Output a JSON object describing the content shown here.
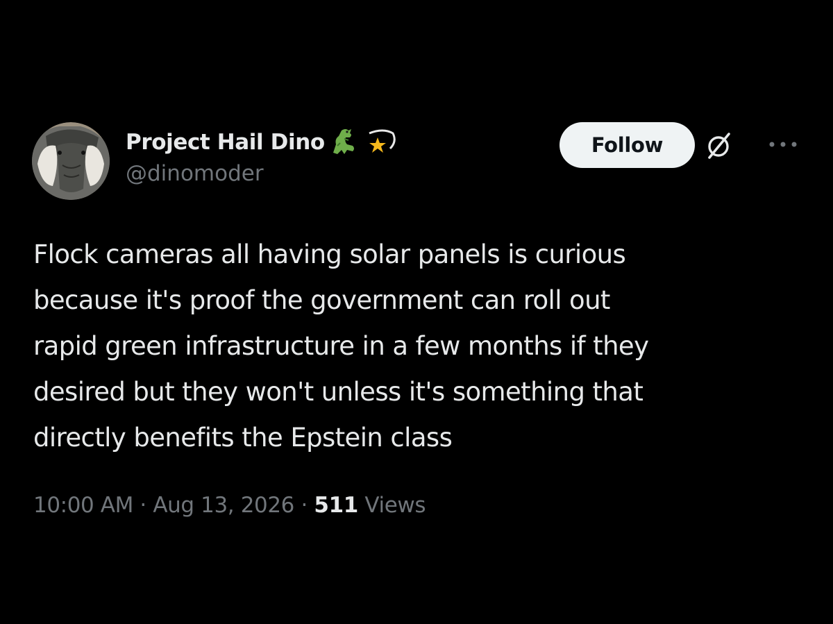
{
  "author": {
    "display_name": "Project Hail Dino",
    "handle": "@dinomoder",
    "avatar_icon": "dinosaur-avatar",
    "name_emojis": [
      "t-rex-emoji",
      "comet-star-emoji"
    ]
  },
  "actions": {
    "follow_label": "Follow",
    "grok_icon": "grok-icon",
    "more_icon": "more-icon"
  },
  "tweet": {
    "lines": [
      "Flock cameras all having solar panels is curious",
      "because it's proof the government can roll out",
      "rapid green infrastructure in a few months if they",
      "desired but they won't unless it's something that",
      "directly benefits the Epstein class"
    ]
  },
  "meta": {
    "time": "10:00 AM",
    "separator": "·",
    "date": "Aug 13, 2026",
    "views_count": "511",
    "views_label": "Views"
  },
  "colors": {
    "background": "#000000",
    "primary_text": "#e7e9ea",
    "secondary_text": "#71767b",
    "follow_bg": "#eff3f4",
    "follow_text": "#0f1419"
  }
}
